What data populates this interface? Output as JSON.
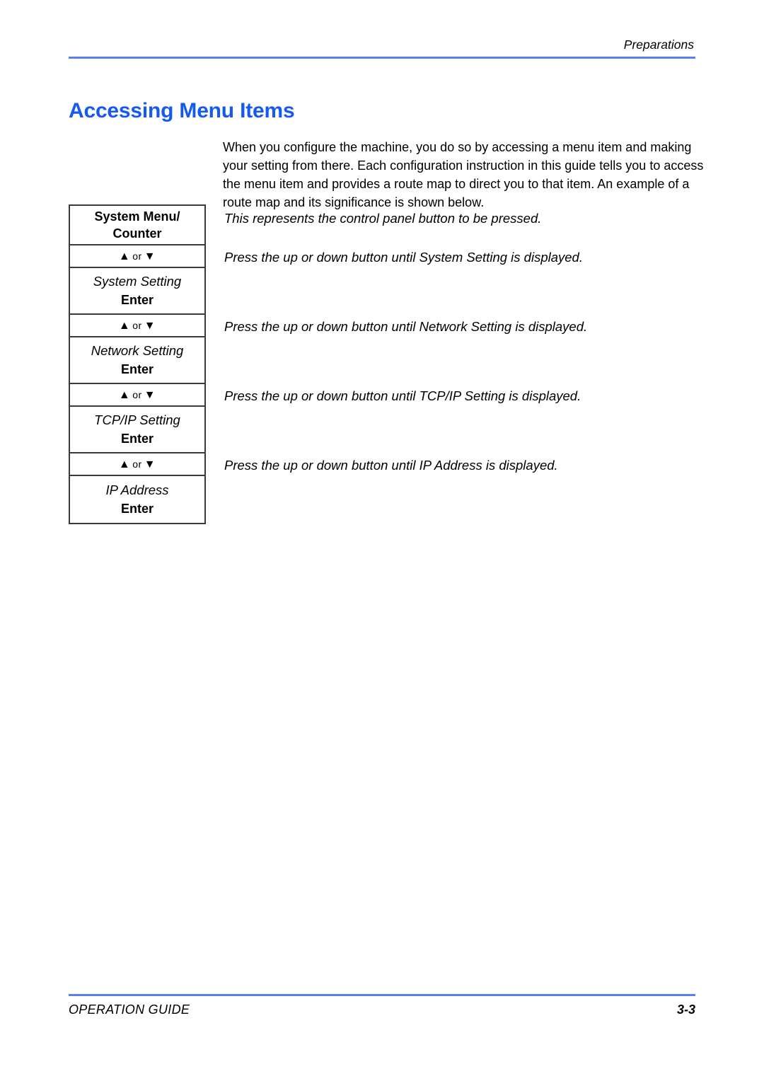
{
  "header": {
    "section_label": "Preparations"
  },
  "title": "Accessing Menu Items",
  "intro": "When you configure the machine, you do so by accessing a menu item and making your setting from there. Each configuration instruction in this guide tells you to access the menu item and provides a route map to direct you to that item. An example of a route map and its significance is shown below.",
  "route_map": {
    "rows": [
      {
        "type": "button",
        "line1": "System Menu/",
        "line2": "Counter"
      },
      {
        "type": "arrow",
        "up": "▲",
        "or": "or",
        "down": "▼"
      },
      {
        "type": "menu",
        "name": "System Setting",
        "key": "Enter"
      },
      {
        "type": "arrow",
        "up": "▲",
        "or": "or",
        "down": "▼"
      },
      {
        "type": "menu",
        "name": "Network Setting",
        "key": "Enter"
      },
      {
        "type": "arrow",
        "up": "▲",
        "or": "or",
        "down": "▼"
      },
      {
        "type": "menu",
        "name": "TCP/IP Setting",
        "key": "Enter"
      },
      {
        "type": "arrow",
        "up": "▲",
        "or": "or",
        "down": "▼"
      },
      {
        "type": "menu",
        "name": "IP Address",
        "key": "Enter"
      }
    ],
    "descriptions": [
      "This represents the control panel button to be pressed.",
      "Press the up or down button until System Setting is displayed.",
      "Press the up or down button until Network Setting is displayed.",
      "Press the up or down button until TCP/IP Setting is displayed.",
      "Press the up or down button until IP Address is displayed."
    ]
  },
  "footer": {
    "guide_label": "OPERATION GUIDE",
    "page_number": "3-3"
  },
  "colors": {
    "heading": "#1559f0",
    "rule": "#5a7df2",
    "border": "#3a3a3a",
    "text": "#000000"
  }
}
